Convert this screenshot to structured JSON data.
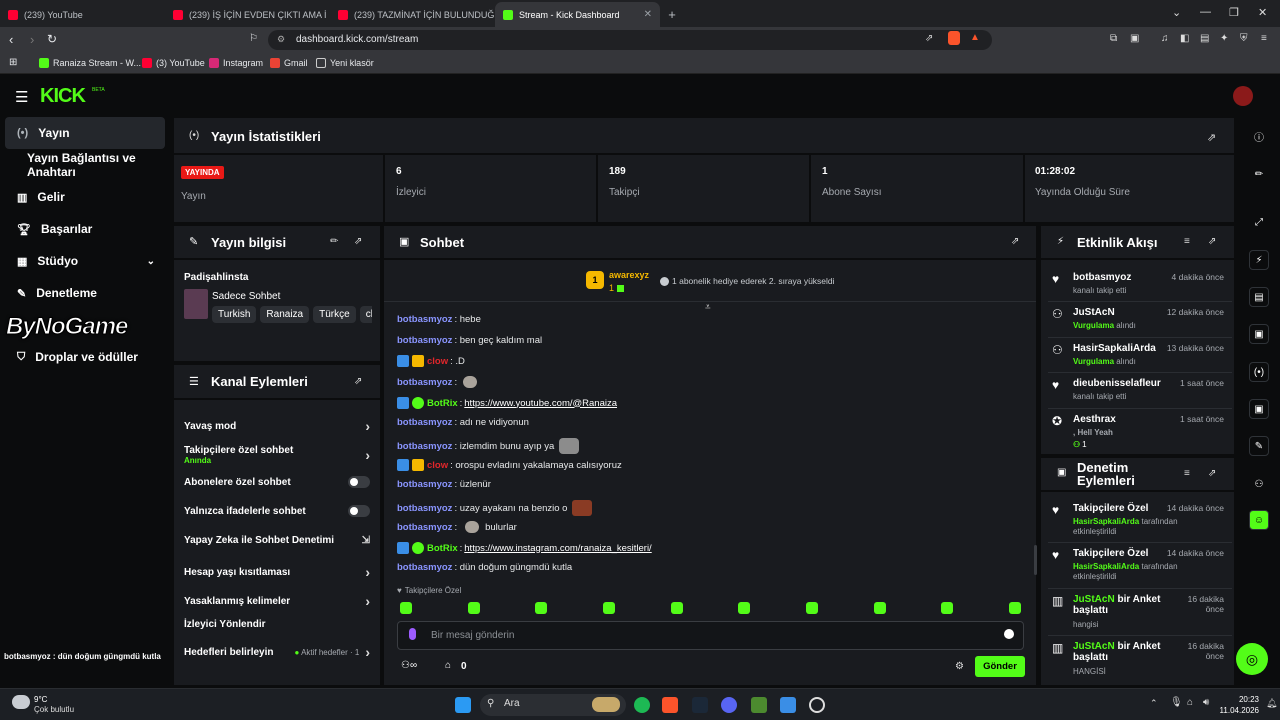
{
  "browser": {
    "tabs": [
      {
        "title": "(239) YouTube",
        "color": "#ff0033"
      },
      {
        "title": "(239) İŞ İÇİN EVDEN ÇIKTI AMA İ",
        "color": "#ff0033"
      },
      {
        "title": "(239) TAZMİNAT İÇİN BULUNDUĞU",
        "color": "#ff0033"
      },
      {
        "title": "Stream - Kick Dashboard",
        "color": "#53fc18"
      }
    ],
    "new_tab": "+",
    "url": "dashboard.kick.com/stream",
    "bookmarks": [
      {
        "label": "Ranaiza Stream - W..."
      },
      {
        "label": "(3) YouTube"
      },
      {
        "label": "Instagram"
      },
      {
        "label": "Gmail"
      },
      {
        "label": "Yeni klasör"
      }
    ]
  },
  "app": {
    "logo": "KICK",
    "logo_sup": "BETA",
    "accent": "#53fc18"
  },
  "sidebar": {
    "items": [
      {
        "label": "Yayın",
        "icon": "broadcast-icon"
      },
      {
        "label": "Yayın Bağlantısı ve Anahtarı",
        "icon": ""
      },
      {
        "label": "Gelir",
        "icon": "chart-icon"
      },
      {
        "label": "Başarılar",
        "icon": "trophy-icon"
      },
      {
        "label": "Stüdyo",
        "icon": "studio-icon"
      },
      {
        "label": "Denetleme",
        "icon": "wrench-icon"
      },
      {
        "label": "Droplar ve ödüller",
        "icon": "gift-icon"
      }
    ],
    "watermark": "ByNoGame",
    "ticker": "botbasmyoz : dün doğum güngmdü kutla"
  },
  "stats": {
    "title": "Yayın İstatistikleri",
    "live_badge": "YAYINDA",
    "live_label": "Yayın",
    "items": [
      {
        "value": "6",
        "label": "İzleyici"
      },
      {
        "value": "189",
        "label": "Takipçi"
      },
      {
        "value": "1",
        "label": "Abone Sayısı"
      },
      {
        "value": "01:28:02",
        "label": "Yayında Olduğu Süre"
      }
    ]
  },
  "stream_info": {
    "title": "Yayın bilgisi",
    "channel": "Padişahlinsta",
    "category": "Sadece Sohbet",
    "tags": [
      "Turkish",
      "Ranaiza",
      "Türkçe",
      "cl"
    ]
  },
  "channel_actions": {
    "title": "Kanal Eylemleri",
    "items": [
      {
        "label": "Yavaş mod",
        "control": "chevron"
      },
      {
        "label": "Takipçilere özel sohbet",
        "sub": "Anında",
        "control": "chevron"
      },
      {
        "label": "Abonelere özel sohbet",
        "control": "toggle"
      },
      {
        "label": "Yalnızca ifadelerle sohbet",
        "control": "toggle"
      },
      {
        "label": "Yapay Zeka ile Sohbet Denetimi",
        "control": "external"
      },
      {
        "label": "Hesap yaşı kısıtlaması",
        "control": "chevron"
      },
      {
        "label": "Yasaklanmış kelimeler",
        "control": "chevron"
      },
      {
        "label": "İzleyici Yönlendir",
        "control": "none"
      },
      {
        "label": "Hedefleri belirleyin",
        "sub": "Aktif hedefler · 1",
        "control": "chevron"
      }
    ]
  },
  "chat": {
    "title": "Sohbet",
    "pinned_user": "awarexyz",
    "pinned_rank": "1",
    "pinned_count": "1",
    "pinned_text": "1 abonelik hediye ederek 2. sıraya yükseldi",
    "messages": [
      {
        "user": "botbasmyoz",
        "text": ": hebe",
        "type": "user"
      },
      {
        "user": "botbasmyoz",
        "text": ": ben geç kaldım mal",
        "type": "user"
      },
      {
        "user": "clow",
        "text": ": .D",
        "type": "mod"
      },
      {
        "user": "botbasmyoz",
        "text": ":",
        "type": "user",
        "emote": true
      },
      {
        "user": "BotRix",
        "text": ": ",
        "link": "https://www.youtube.com/@Ranaiza",
        "type": "bot"
      },
      {
        "user": "botbasmyoz",
        "text": ": adı ne vidiyonun",
        "type": "user"
      },
      {
        "user": "botbasmyoz",
        "text": ": izlemdim bunu ayıp ya",
        "type": "user",
        "emote": true
      },
      {
        "user": "clow",
        "text": ": orospu evladını yakalamaya calısıyoruz",
        "type": "mod"
      },
      {
        "user": "botbasmyoz",
        "text": ": üzlenür",
        "type": "user"
      },
      {
        "user": "botbasmyoz",
        "text": ": uzay ayakanı na benzio o",
        "type": "user",
        "emote": true
      },
      {
        "user": "botbasmyoz",
        "text": ":",
        "type": "user",
        "emote": true,
        "after": "bulurlar"
      },
      {
        "user": "BotRix",
        "text": ": ",
        "link": "https://www.instagram.com/ranaiza_kesitleri/",
        "type": "bot"
      },
      {
        "user": "botbasmyoz",
        "text": ": dün doğum güngmdü kutla",
        "type": "user"
      }
    ],
    "followers_only": "Takipçilere Özel",
    "input_placeholder": "Bir mesaj gönderin",
    "points": "0",
    "send": "Gönder"
  },
  "activity": {
    "title": "Etkinlik Akışı",
    "events": [
      {
        "name": "botbasmyoz",
        "time": "4 dakika önce",
        "sub": "kanalı takip etti",
        "icon": "heart-icon"
      },
      {
        "name": "JuStAcN",
        "time": "12 dakika önce",
        "sub_green": "Vurgulama",
        "sub": "alındı",
        "icon": "points-icon"
      },
      {
        "name": "HasirSapkaliArda",
        "time": "13 dakika önce",
        "sub_green": "Vurgulama",
        "sub": "alındı",
        "icon": "points-icon"
      },
      {
        "name": "dieubenisselafleur",
        "time": "1 saat önce",
        "sub": "kanalı takip etti",
        "icon": "heart-icon"
      },
      {
        "name": "Aesthrax",
        "time": "1 saat önce",
        "sub_green": ", Hell Yeah",
        "sub": "",
        "extra": "1",
        "icon": "kick-icon"
      }
    ]
  },
  "moderation": {
    "title": "Denetim Eylemleri",
    "events": [
      {
        "name": "Takipçilere Özel",
        "time": "14 dakika önce",
        "green": "HasirSapkaliArda",
        "sub": "tarafından",
        "sub2": "etkinleştirildi",
        "icon": "heart-icon"
      },
      {
        "name": "Takipçilere Özel",
        "time": "14 dakika önce",
        "green": "HasirSapkaliArda",
        "sub": "tarafından",
        "sub2": "etkinleştirildi",
        "icon": "heart-icon"
      },
      {
        "name_green": "JuStAcN",
        "name": "bir Anket",
        "name2": "başlattı",
        "time": "16 dakika",
        "time2": "önce",
        "sub": "hangisi",
        "icon": "poll-icon"
      },
      {
        "name_green": "JuStAcN",
        "name": "bir Anket",
        "name2": "başlattı",
        "time": "16 dakika",
        "time2": "önce",
        "sub": "HANGİSİ",
        "icon": "poll-icon"
      }
    ]
  },
  "taskbar": {
    "weather_temp": "9°C",
    "weather_desc": "Çok bulutlu",
    "search": "Ara",
    "time": "20:23",
    "date": "11.04.2026"
  }
}
